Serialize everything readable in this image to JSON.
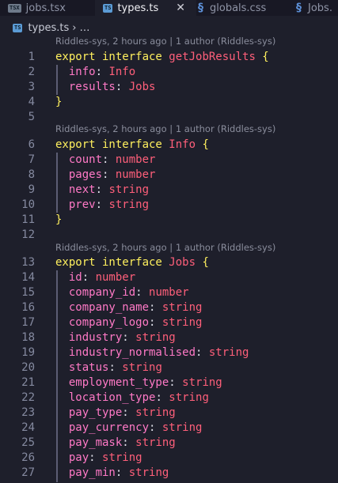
{
  "tabs": [
    {
      "label": "jobs.tsx",
      "badge": "TSX",
      "icon": "tsx-file-icon"
    },
    {
      "label": "types.ts",
      "badge": "TS",
      "icon": "ts-file-icon",
      "close": "✕"
    },
    {
      "label": "globals.css",
      "badge": "§",
      "icon": "css-file-icon"
    },
    {
      "label": "Jobs.",
      "badge": "§",
      "icon": "css-file-icon"
    }
  ],
  "breadcrumb": {
    "file": "types.ts",
    "badge": "TS",
    "chevron": "›",
    "more": "…"
  },
  "codelens": {
    "blame_1": "Riddles-sys, 2 hours ago | 1 author (Riddles-sys)",
    "blame_2": "Riddles-sys, 2 hours ago | 1 author (Riddles-sys)",
    "blame_3": "Riddles-sys, 2 hours ago | 1 author (Riddles-sys)"
  },
  "lines": [
    {
      "n": "1",
      "kw": "export interface ",
      "name": "getJobResults",
      "brace": " {"
    },
    {
      "n": "2",
      "prop": "info",
      "type": "Info"
    },
    {
      "n": "3",
      "prop": "results",
      "type": "Jobs"
    },
    {
      "n": "4",
      "brace": "}"
    },
    {
      "n": "5"
    },
    {
      "n": "6",
      "kw": "export interface ",
      "name": "Info",
      "brace": " {"
    },
    {
      "n": "7",
      "prop": "count",
      "type": "number"
    },
    {
      "n": "8",
      "prop": "pages",
      "type": "number"
    },
    {
      "n": "9",
      "prop": "next",
      "type": "string"
    },
    {
      "n": "10",
      "prop": "prev",
      "type": "string"
    },
    {
      "n": "11",
      "brace": "}"
    },
    {
      "n": "12"
    },
    {
      "n": "13",
      "kw": "export interface ",
      "name": "Jobs",
      "brace": " {"
    },
    {
      "n": "14",
      "prop": "id",
      "type": "number"
    },
    {
      "n": "15",
      "prop": "company_id",
      "type": "number"
    },
    {
      "n": "16",
      "prop": "company_name",
      "type": "string"
    },
    {
      "n": "17",
      "prop": "company_logo",
      "type": "string"
    },
    {
      "n": "18",
      "prop": "industry",
      "type": "string"
    },
    {
      "n": "19",
      "prop": "industry_normalised",
      "type": "string"
    },
    {
      "n": "20",
      "prop": "status",
      "type": "string"
    },
    {
      "n": "21",
      "prop": "employment_type",
      "type": "string"
    },
    {
      "n": "22",
      "prop": "location_type",
      "type": "string"
    },
    {
      "n": "23",
      "prop": "pay_type",
      "type": "string"
    },
    {
      "n": "24",
      "prop": "pay_currency",
      "type": "string"
    },
    {
      "n": "25",
      "prop": "pay_mask",
      "type": "string"
    },
    {
      "n": "26",
      "prop": "pay",
      "type": "string"
    },
    {
      "n": "27",
      "prop": "pay_min",
      "type": "string"
    }
  ]
}
